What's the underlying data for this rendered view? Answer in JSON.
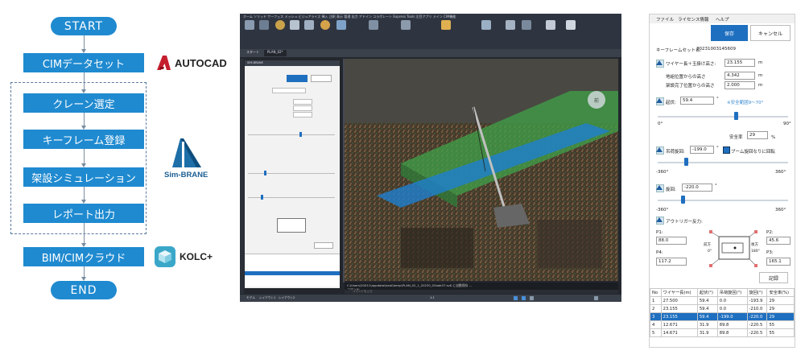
{
  "flowchart": {
    "start": "START",
    "steps": [
      "CIMデータセット",
      "クレーン選定",
      "キーフレーム登録",
      "架設シミュレーション",
      "レポート出力",
      "BIM/CIMクラウド"
    ],
    "end": "END",
    "colors": {
      "node": "#1f8ad0",
      "connector": "#7a8da0",
      "group_border": "#5a7aa0"
    }
  },
  "logos": {
    "autocad": "AUTOCAD",
    "simbrane": "Sim-BRANE",
    "kolc": "KOLC+"
  },
  "cad": {
    "menu": "ホーム  ソリッド  サーフェス  メッシュ  ビジュアライズ  挿入  注釈  表示  管理  出力  アドイン  コラボレート  Express Tools  注目アプリ  メイン  CIM機能",
    "tabs": [
      "スタート",
      "PLAN_02*"
    ],
    "layout_tabs": [
      "モデル",
      "レイアウト1",
      "レイアウト2"
    ],
    "panel_title": "SIM-BRANE",
    "command_line": "C:\\Users\\20011\\appdata\\local\\temp\\PLAN_02_1_20230_03aab37.sv$ に自動保存 ...",
    "command_line2": "コマンド:",
    "command_prompt": "コマンドを入力",
    "status_scale": "1:1",
    "view_label": "前"
  },
  "right_panel": {
    "menu": [
      "ファイル",
      "ライセンス情報",
      "ヘルプ"
    ],
    "save_label": "保存",
    "cancel_label": "キャンセル",
    "keyframe_label": "キーフレームセット名:",
    "keyframe_value": "20231003145609",
    "wire_label": "ワイヤー長＋玉掛け高さ:",
    "wire_value": "23.155",
    "ground_label": "地組位置からの高さ",
    "ground_value": "4.342",
    "install_label": "架設完了位置からの高さ",
    "install_value": "2.000",
    "unit_m": "m",
    "boom_label": "起伏:",
    "boom_value": "59.4",
    "deg": "°",
    "safe_range": "※安全範囲9～70°",
    "boom_min": "0°",
    "boom_max": "90°",
    "safety_label": "安全率",
    "safety_value": "29",
    "pct": "%",
    "swing_label": "吊荷旋回:",
    "swing_value": "-199.0",
    "swing_check": "ブーム旋回なりに回転",
    "swing_min": "-360°",
    "swing_max": "360°",
    "rotate_label": "旋回:",
    "rotate_value": "-220.0",
    "rotate_min": "-360°",
    "rotate_max": "360°",
    "outrigger_label": "アウトリガー反力:",
    "p1_label": "P1:",
    "p1_value": "88.0",
    "p2_label": "P2:",
    "p2_value": "45.6",
    "p3_label": "P3:",
    "p3_value": "165.1",
    "p4_label": "P4:",
    "p4_value": "117.2",
    "front_label": "前方",
    "rear_label": "後方",
    "deg0": "0°",
    "deg180": "180°",
    "record_label": "記録",
    "table": {
      "headers": [
        "No",
        "ワイヤー長(m)",
        "起伏(°)",
        "吊荷旋回(°)",
        "旋回(°)",
        "安全率(%)"
      ],
      "rows": [
        [
          "1",
          "27.500",
          "59.4",
          "0.0",
          "-193.9",
          "29"
        ],
        [
          "2",
          "23.155",
          "59.4",
          "0.0",
          "-210.0",
          "29"
        ],
        [
          "3",
          "23.155",
          "59.4",
          "-199.0",
          "-220.0",
          "29"
        ],
        [
          "4",
          "12.671",
          "31.9",
          "89.8",
          "-220.5",
          "55"
        ],
        [
          "5",
          "14.671",
          "31.9",
          "89.8",
          "-220.5",
          "55"
        ]
      ],
      "selected_row": 3
    },
    "colors": {
      "accent": "#1f6fc0",
      "button_fill": "#1f6fc0"
    }
  }
}
